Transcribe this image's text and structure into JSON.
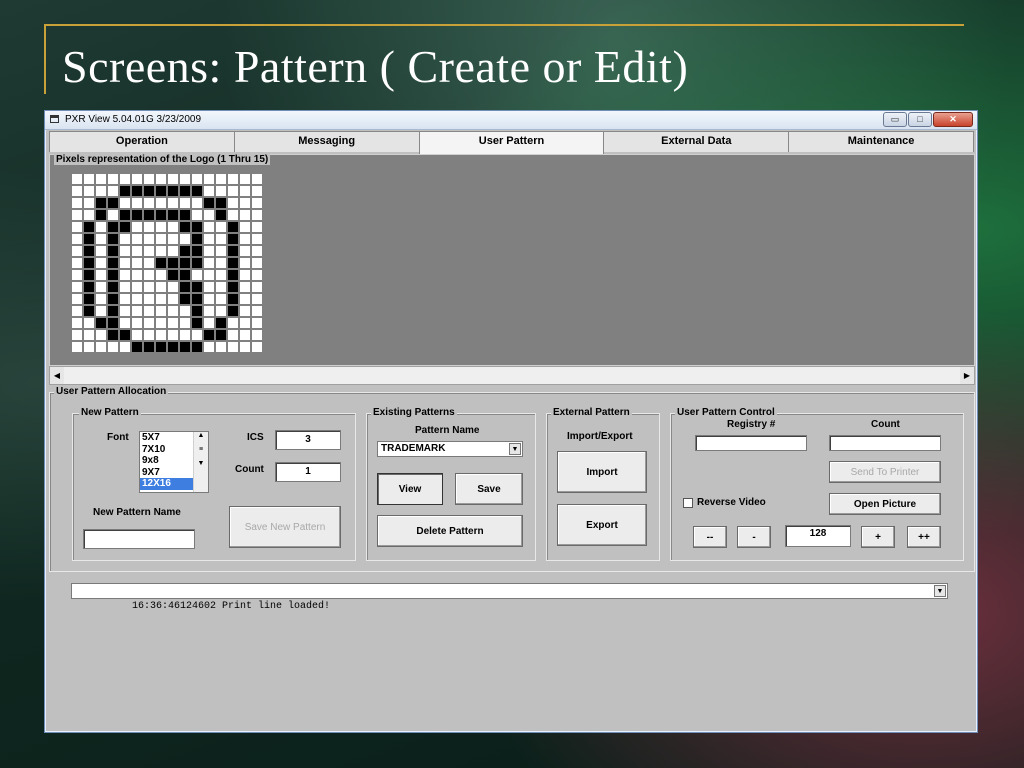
{
  "slide": {
    "title": "Screens: Pattern ( Create or Edit)"
  },
  "window": {
    "title": "PXR View 5.04.01G 3/23/2009",
    "minimize": "▭",
    "maximize": "□",
    "close": "✕"
  },
  "tabs": [
    "Operation",
    "Messaging",
    "User Pattern",
    "External Data",
    "Maintenance"
  ],
  "active_tab": "User Pattern",
  "pixels": {
    "label": "Pixels representation of the Logo (1 Thru 15)",
    "columns": 16,
    "rows": [
      "0000000000000000",
      "0000111111100000",
      "0011000000011000",
      "0010111111001000",
      "0101100001100100",
      "0101000000100100",
      "0101000001100100",
      "0101000111100100",
      "0101000011000100",
      "0101000001100100",
      "0101000001100100",
      "0101000000100100",
      "0011000000101000",
      "0001100000011000",
      "0000011111100000"
    ]
  },
  "allocation": {
    "label": "User Pattern Allocation",
    "new_pattern": {
      "label": "New Pattern",
      "font_label": "Font",
      "fonts": [
        "5X7",
        "7X10",
        "9x8",
        "9X7",
        "12X16"
      ],
      "selected_font": "12X16",
      "ics_label": "ICS",
      "ics_value": "3",
      "count_label": "Count",
      "count_value": "1",
      "name_label": "New Pattern Name",
      "name_value": "",
      "save_button": "Save New Pattern"
    },
    "existing": {
      "label": "Existing Patterns",
      "name_label": "Pattern Name",
      "selected": "TRADEMARK",
      "view_button": "View",
      "save_button": "Save",
      "delete_button": "Delete Pattern"
    },
    "external": {
      "label": "External Pattern",
      "sub_label": "Import/Export",
      "import_button": "Import",
      "export_button": "Export"
    },
    "control": {
      "label": "User Pattern Control",
      "registry_label": "Registry #",
      "registry_value": "",
      "count_label": "Count",
      "count_value": "",
      "send_button": "Send To Printer",
      "reverse_label": "Reverse Video",
      "reverse_checked": false,
      "open_button": "Open Picture",
      "dec_fast": "--",
      "dec": "-",
      "value": "128",
      "inc": "+",
      "inc_fast": "++"
    }
  },
  "log": {
    "line": "16:36:46124602 Print line loaded!"
  }
}
